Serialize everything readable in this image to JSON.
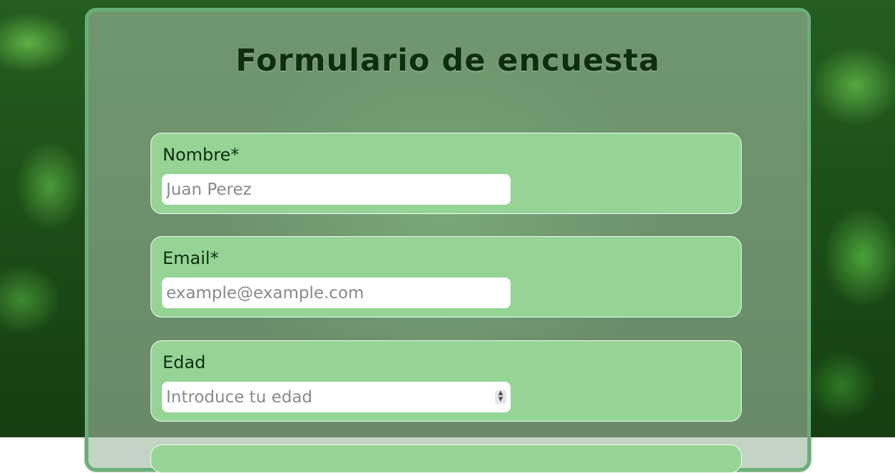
{
  "form": {
    "title": "Formulario de encuesta",
    "fields": [
      {
        "label": "Nombre*",
        "placeholder": "Juan Perez",
        "type": "text"
      },
      {
        "label": "Email*",
        "placeholder": "example@example.com",
        "type": "email"
      },
      {
        "label": "Edad",
        "placeholder": "Introduce tu edad",
        "type": "number"
      }
    ]
  },
  "colors": {
    "card_border": "#6aae79",
    "group_background": "#95d495",
    "title_text": "#0f2e10"
  },
  "icons": {
    "number_spinner": "spinner-up-down-icon"
  }
}
